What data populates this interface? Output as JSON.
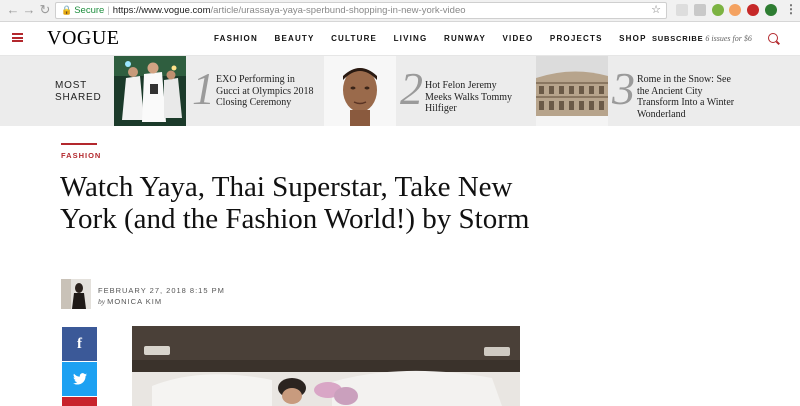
{
  "browser": {
    "secure_label": "Secure",
    "url_host": "https://www.vogue.com",
    "url_path": "/article/urassaya-yaya-sperbund-shopping-in-new-york-video"
  },
  "site": {
    "logo": "VOGUE",
    "nav": [
      "FASHION",
      "BEAUTY",
      "CULTURE",
      "LIVING",
      "RUNWAY",
      "VIDEO",
      "PROJECTS",
      "SHOP"
    ],
    "subscribe_label": "SUBSCRIBE",
    "subscribe_offer": "6 issues for $6",
    "accent_color": "#b3282d"
  },
  "most_shared": {
    "label_line1": "MOST",
    "label_line2": "SHARED",
    "items": [
      {
        "number": "1",
        "title": "EXO Performing in Gucci at Olympics 2018 Closing Ceremony"
      },
      {
        "number": "2",
        "title": "Hot Felon Jeremy Meeks Walks Tommy Hilfiger"
      },
      {
        "number": "3",
        "title": "Rome in the Snow: See the Ancient City Transform Into a Winter Wonderland"
      }
    ]
  },
  "article": {
    "kicker": "FASHION",
    "headline": "Watch Yaya, Thai Superstar, Take New York (and the Fashion World!) by Storm",
    "date": "FEBRUARY 27, 2018 8:15 PM",
    "by": "by",
    "author": "MONICA KIM"
  },
  "social": {
    "facebook_glyph": "f",
    "twitter_glyph": "twitter"
  }
}
